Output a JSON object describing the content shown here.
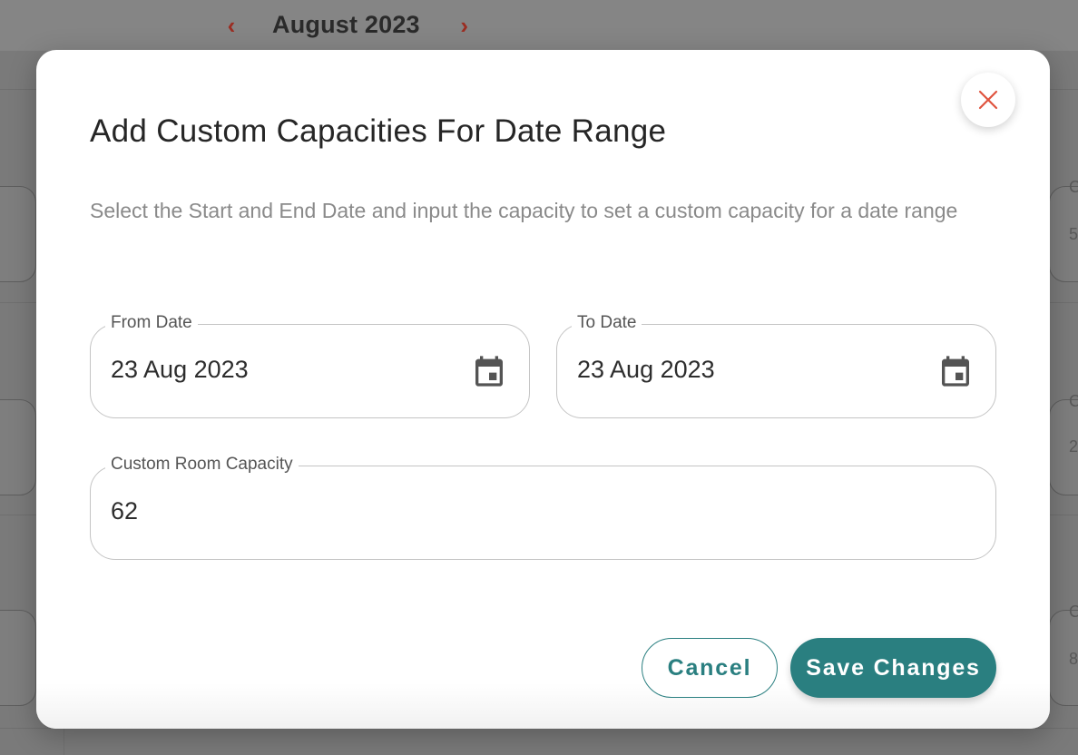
{
  "background": {
    "month_label": "August 2023",
    "prev_icon": "chevron-left-icon",
    "next_icon": "chevron-right-icon",
    "edge_glyphs": [
      "C",
      "5",
      "C",
      "2",
      "C",
      "8"
    ]
  },
  "modal": {
    "title": "Add Custom Capacities For Date Range",
    "description": "Select the Start and End Date and input the capacity to set a custom capacity for a date range",
    "close_icon": "close-icon",
    "fields": {
      "from_date": {
        "label": "From Date",
        "value": "23 Aug 2023",
        "icon": "calendar-icon"
      },
      "to_date": {
        "label": "To Date",
        "value": "23 Aug 2023",
        "icon": "calendar-icon"
      },
      "capacity": {
        "label": "Custom Room Capacity",
        "value": "62"
      }
    },
    "buttons": {
      "cancel": "Cancel",
      "save": "Save Changes"
    }
  },
  "colors": {
    "accent": "#2a7f80",
    "close_icon": "#e0533e",
    "nav_arrow": "#9b2d22",
    "overlay": "#7a7a7a"
  }
}
